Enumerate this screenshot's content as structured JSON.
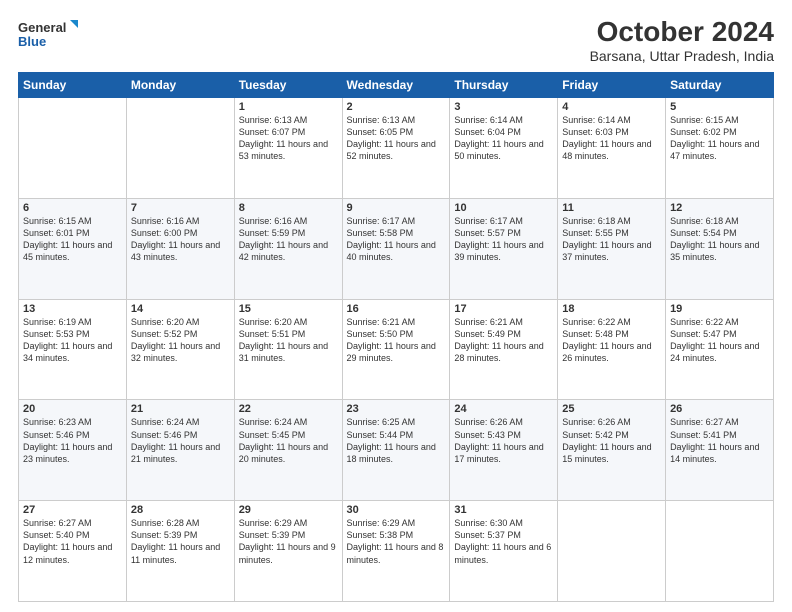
{
  "logo": {
    "line1": "General",
    "line2": "Blue"
  },
  "title": "October 2024",
  "subtitle": "Barsana, Uttar Pradesh, India",
  "headers": [
    "Sunday",
    "Monday",
    "Tuesday",
    "Wednesday",
    "Thursday",
    "Friday",
    "Saturday"
  ],
  "weeks": [
    [
      {
        "day": "",
        "info": ""
      },
      {
        "day": "",
        "info": ""
      },
      {
        "day": "1",
        "info": "Sunrise: 6:13 AM\nSunset: 6:07 PM\nDaylight: 11 hours and 53 minutes."
      },
      {
        "day": "2",
        "info": "Sunrise: 6:13 AM\nSunset: 6:05 PM\nDaylight: 11 hours and 52 minutes."
      },
      {
        "day": "3",
        "info": "Sunrise: 6:14 AM\nSunset: 6:04 PM\nDaylight: 11 hours and 50 minutes."
      },
      {
        "day": "4",
        "info": "Sunrise: 6:14 AM\nSunset: 6:03 PM\nDaylight: 11 hours and 48 minutes."
      },
      {
        "day": "5",
        "info": "Sunrise: 6:15 AM\nSunset: 6:02 PM\nDaylight: 11 hours and 47 minutes."
      }
    ],
    [
      {
        "day": "6",
        "info": "Sunrise: 6:15 AM\nSunset: 6:01 PM\nDaylight: 11 hours and 45 minutes."
      },
      {
        "day": "7",
        "info": "Sunrise: 6:16 AM\nSunset: 6:00 PM\nDaylight: 11 hours and 43 minutes."
      },
      {
        "day": "8",
        "info": "Sunrise: 6:16 AM\nSunset: 5:59 PM\nDaylight: 11 hours and 42 minutes."
      },
      {
        "day": "9",
        "info": "Sunrise: 6:17 AM\nSunset: 5:58 PM\nDaylight: 11 hours and 40 minutes."
      },
      {
        "day": "10",
        "info": "Sunrise: 6:17 AM\nSunset: 5:57 PM\nDaylight: 11 hours and 39 minutes."
      },
      {
        "day": "11",
        "info": "Sunrise: 6:18 AM\nSunset: 5:55 PM\nDaylight: 11 hours and 37 minutes."
      },
      {
        "day": "12",
        "info": "Sunrise: 6:18 AM\nSunset: 5:54 PM\nDaylight: 11 hours and 35 minutes."
      }
    ],
    [
      {
        "day": "13",
        "info": "Sunrise: 6:19 AM\nSunset: 5:53 PM\nDaylight: 11 hours and 34 minutes."
      },
      {
        "day": "14",
        "info": "Sunrise: 6:20 AM\nSunset: 5:52 PM\nDaylight: 11 hours and 32 minutes."
      },
      {
        "day": "15",
        "info": "Sunrise: 6:20 AM\nSunset: 5:51 PM\nDaylight: 11 hours and 31 minutes."
      },
      {
        "day": "16",
        "info": "Sunrise: 6:21 AM\nSunset: 5:50 PM\nDaylight: 11 hours and 29 minutes."
      },
      {
        "day": "17",
        "info": "Sunrise: 6:21 AM\nSunset: 5:49 PM\nDaylight: 11 hours and 28 minutes."
      },
      {
        "day": "18",
        "info": "Sunrise: 6:22 AM\nSunset: 5:48 PM\nDaylight: 11 hours and 26 minutes."
      },
      {
        "day": "19",
        "info": "Sunrise: 6:22 AM\nSunset: 5:47 PM\nDaylight: 11 hours and 24 minutes."
      }
    ],
    [
      {
        "day": "20",
        "info": "Sunrise: 6:23 AM\nSunset: 5:46 PM\nDaylight: 11 hours and 23 minutes."
      },
      {
        "day": "21",
        "info": "Sunrise: 6:24 AM\nSunset: 5:46 PM\nDaylight: 11 hours and 21 minutes."
      },
      {
        "day": "22",
        "info": "Sunrise: 6:24 AM\nSunset: 5:45 PM\nDaylight: 11 hours and 20 minutes."
      },
      {
        "day": "23",
        "info": "Sunrise: 6:25 AM\nSunset: 5:44 PM\nDaylight: 11 hours and 18 minutes."
      },
      {
        "day": "24",
        "info": "Sunrise: 6:26 AM\nSunset: 5:43 PM\nDaylight: 11 hours and 17 minutes."
      },
      {
        "day": "25",
        "info": "Sunrise: 6:26 AM\nSunset: 5:42 PM\nDaylight: 11 hours and 15 minutes."
      },
      {
        "day": "26",
        "info": "Sunrise: 6:27 AM\nSunset: 5:41 PM\nDaylight: 11 hours and 14 minutes."
      }
    ],
    [
      {
        "day": "27",
        "info": "Sunrise: 6:27 AM\nSunset: 5:40 PM\nDaylight: 11 hours and 12 minutes."
      },
      {
        "day": "28",
        "info": "Sunrise: 6:28 AM\nSunset: 5:39 PM\nDaylight: 11 hours and 11 minutes."
      },
      {
        "day": "29",
        "info": "Sunrise: 6:29 AM\nSunset: 5:39 PM\nDaylight: 11 hours and 9 minutes."
      },
      {
        "day": "30",
        "info": "Sunrise: 6:29 AM\nSunset: 5:38 PM\nDaylight: 11 hours and 8 minutes."
      },
      {
        "day": "31",
        "info": "Sunrise: 6:30 AM\nSunset: 5:37 PM\nDaylight: 11 hours and 6 minutes."
      },
      {
        "day": "",
        "info": ""
      },
      {
        "day": "",
        "info": ""
      }
    ]
  ]
}
